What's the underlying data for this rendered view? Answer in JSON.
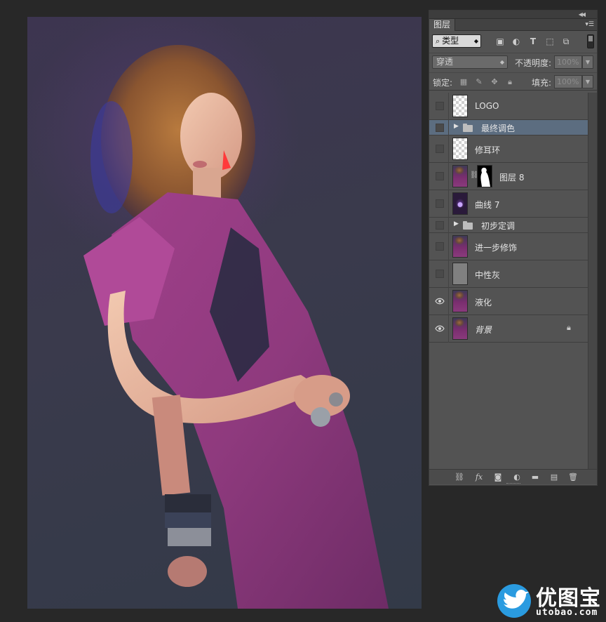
{
  "colors": {
    "app_bg": "#282828",
    "panel_bg": "#535353",
    "selected_row": "#5c6d80",
    "watermark_blue": "#2a9be0"
  },
  "panel": {
    "tab_label": "图层",
    "filter": {
      "selected": "类型",
      "search_icon": "search-icon"
    },
    "blend_mode": "穿透",
    "opacity_label": "不透明度:",
    "opacity_value": "100%",
    "lock_label": "锁定:",
    "fill_label": "填充:",
    "fill_value": "100%"
  },
  "layers": [
    {
      "name": "LOGO",
      "kind": "layer",
      "visible": false,
      "selected": false
    },
    {
      "name": "最终调色",
      "kind": "group",
      "visible": false,
      "selected": true
    },
    {
      "name": "修耳环",
      "kind": "layer",
      "visible": false,
      "selected": false
    },
    {
      "name": "图层 8",
      "kind": "layer-with-mask",
      "visible": false,
      "selected": false
    },
    {
      "name": "曲线 7",
      "kind": "layer",
      "visible": false,
      "selected": false
    },
    {
      "name": "初步定调",
      "kind": "group",
      "visible": false,
      "selected": false
    },
    {
      "name": "进一步修饰",
      "kind": "layer",
      "visible": false,
      "selected": false
    },
    {
      "name": "中性灰",
      "kind": "layer",
      "visible": false,
      "selected": false
    },
    {
      "name": "液化",
      "kind": "layer",
      "visible": true,
      "selected": false
    },
    {
      "name": "背景",
      "kind": "background",
      "visible": true,
      "selected": false,
      "locked": true
    }
  ],
  "watermark": {
    "title": "优图宝",
    "url": "utobao.com"
  }
}
